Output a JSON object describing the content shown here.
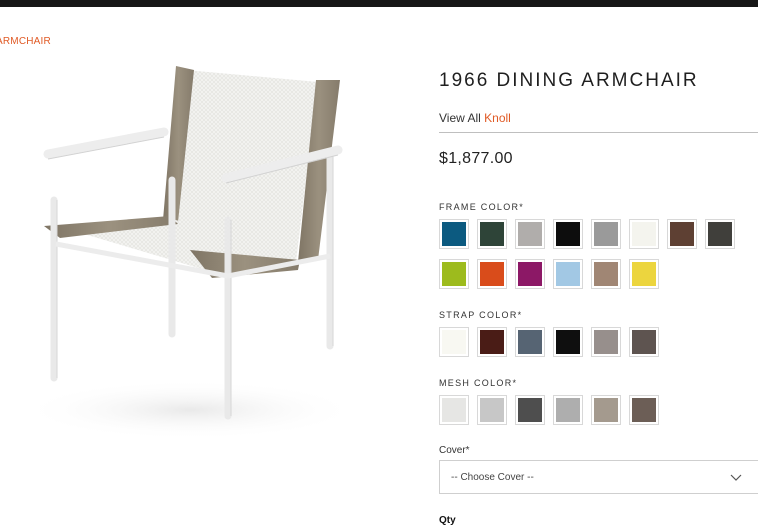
{
  "breadcrumb": "ARMCHAIR",
  "product": {
    "title": "1966 DINING ARMCHAIR",
    "view_all_prefix": "View All",
    "view_all_brand": "Knoll",
    "price": "$1,877.00"
  },
  "frame_color": {
    "label": "FRAME COLOR*",
    "swatches": [
      "#0c5a80",
      "#2e4438",
      "#b0adab",
      "#0d0d0d",
      "#9a9a9a",
      "#f4f4ee",
      "#5e4033",
      "#403f3b",
      "#9dbb1d",
      "#d94c1b",
      "#8c1866",
      "#a2c8e4",
      "#a08674",
      "#ecd53e"
    ]
  },
  "strap_color": {
    "label": "STRAP COLOR*",
    "swatches": [
      "#f8f8f2",
      "#4a1c16",
      "#566473",
      "#0f0f0f",
      "#978f8c",
      "#5e5450"
    ]
  },
  "mesh_color": {
    "label": "MESH COLOR*",
    "swatches": [
      "#e6e6e4",
      "#c7c7c7",
      "#4e4e4e",
      "#aeaeae",
      "#a49a8e",
      "#6c5e56"
    ]
  },
  "cover": {
    "label": "Cover*",
    "value": "-- Choose Cover --"
  },
  "qty_label": "Qty",
  "icons": {
    "select": "chevron-down-icon"
  }
}
